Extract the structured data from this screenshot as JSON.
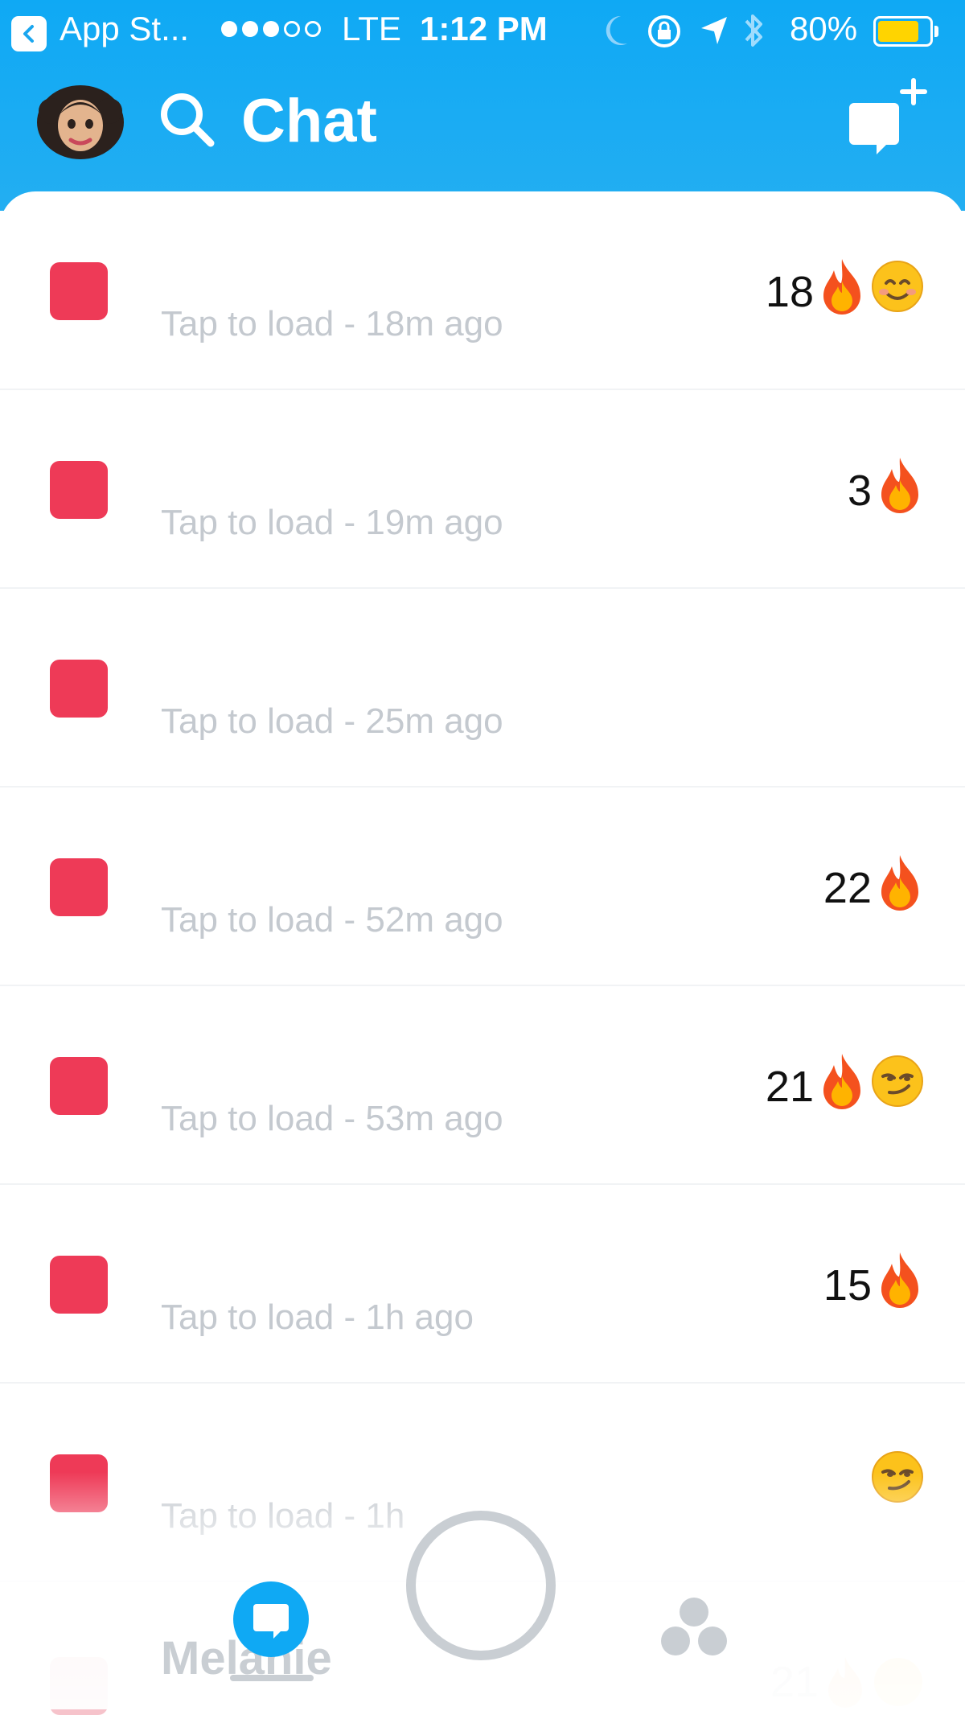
{
  "status_bar": {
    "back_app": "App St...",
    "network": "LTE",
    "time": "1:12 PM",
    "battery": "80%",
    "battery_level": 0.8,
    "signal_bars_filled": 3,
    "signal_bars_total": 5
  },
  "header": {
    "title": "Chat"
  },
  "chats": [
    {
      "status": "Tap to load - 18m ago",
      "streak": "18",
      "fire": true,
      "emoji": "smiling-face-icon"
    },
    {
      "status": "Tap to load - 19m ago",
      "streak": "3",
      "fire": true,
      "emoji": ""
    },
    {
      "status": "Tap to load - 25m ago",
      "streak": "",
      "fire": false,
      "emoji": ""
    },
    {
      "status": "Tap to load - 52m ago",
      "streak": "22",
      "fire": true,
      "emoji": ""
    },
    {
      "status": "Tap to load - 53m ago",
      "streak": "21",
      "fire": true,
      "emoji": "smirking-face-icon"
    },
    {
      "status": "Tap to load - 1h ago",
      "streak": "15",
      "fire": true,
      "emoji": ""
    },
    {
      "status": "Tap to load - 1h",
      "streak": "",
      "fire": false,
      "emoji": "smirking-face-icon"
    }
  ],
  "peek_row": {
    "name": "Melanie",
    "streak": "21"
  },
  "colors": {
    "header_blue": "#0fa9f4",
    "snap_red": "#ee3a57",
    "battery_yellow": "#ffd400",
    "muted_text": "#c4c9cf"
  }
}
